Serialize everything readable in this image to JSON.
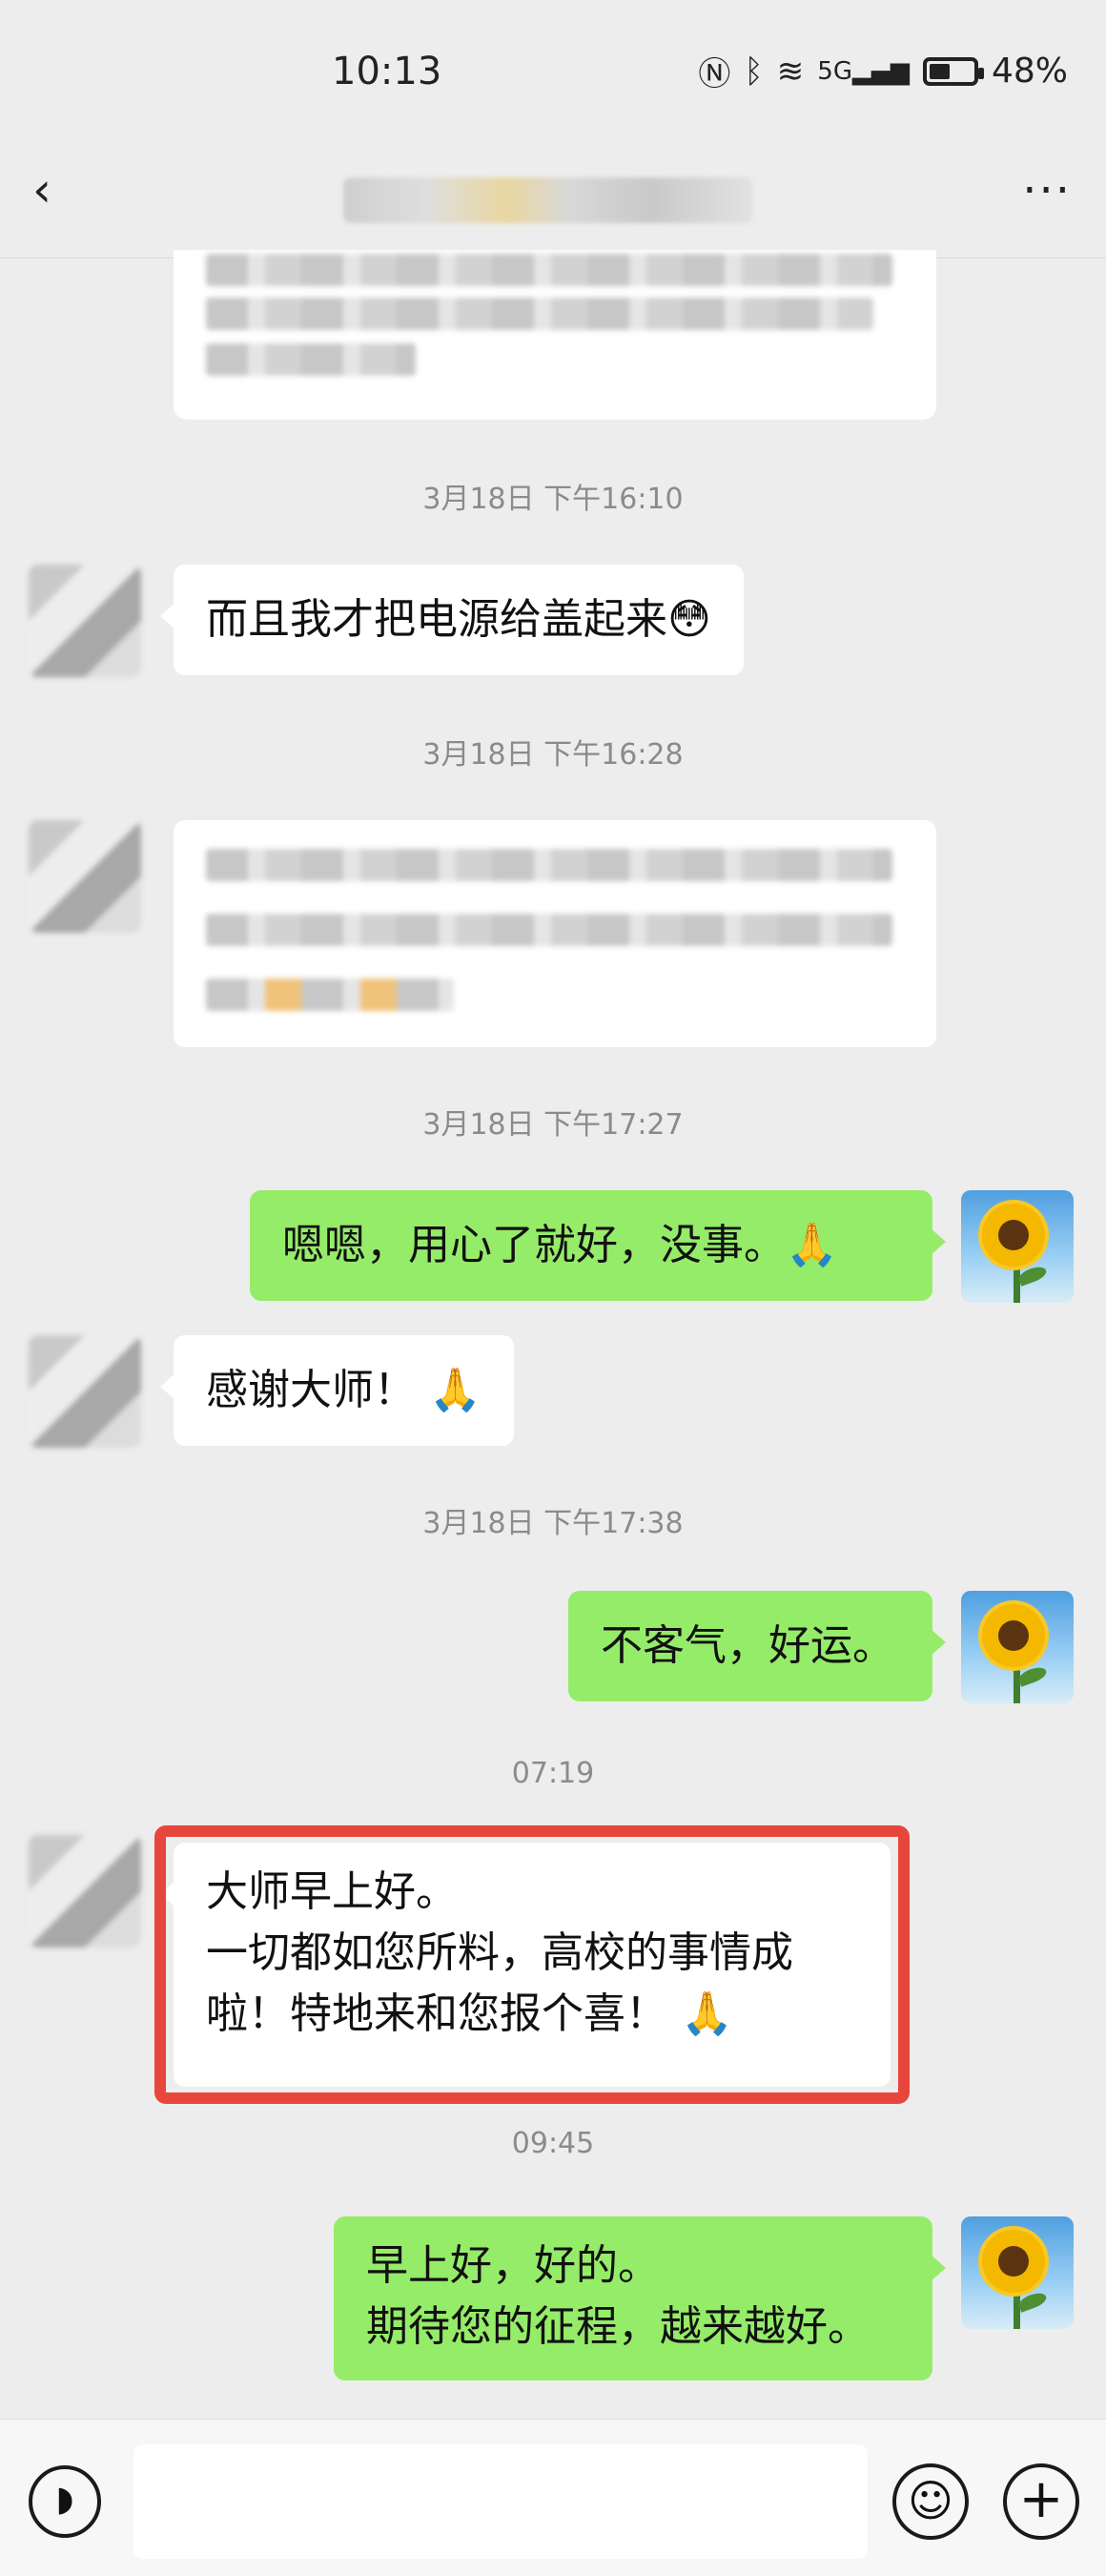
{
  "status": {
    "time": "10:13",
    "network": "5G",
    "battery": "48%"
  },
  "nav": {
    "back_icon": "back-arrow-icon",
    "title": "",
    "more_icon": "more-dots-icon"
  },
  "messages": [
    {
      "type": "timestamp",
      "text": "3月18日 下午16:10"
    },
    {
      "type": "in",
      "text": "而且我才把电源给盖起来😳"
    },
    {
      "type": "timestamp",
      "text": "3月18日 下午16:28"
    },
    {
      "type": "timestamp",
      "text": "3月18日 下午17:27"
    },
    {
      "type": "out",
      "text": "嗯嗯，用心了就好，没事。🙏"
    },
    {
      "type": "in",
      "text": "感谢大师！ 🙏"
    },
    {
      "type": "timestamp",
      "text": "3月18日 下午17:38"
    },
    {
      "type": "out",
      "text": "不客气，好运。"
    },
    {
      "type": "timestamp",
      "text": "07:19"
    },
    {
      "type": "in",
      "lines": [
        "大师早上好。",
        "一切都如您所料，高校的事情成",
        "啦！特地来和您报个喜！ 🙏"
      ]
    },
    {
      "type": "timestamp",
      "text": "09:45"
    },
    {
      "type": "out",
      "lines": [
        "早上好，好的。",
        "期待您的征程，越来越好。"
      ]
    }
  ],
  "input_bar": {
    "voice_icon": "voice-icon",
    "placeholder": "",
    "emoji_icon": "emoji-icon",
    "plus_icon": "plus-icon"
  },
  "colors": {
    "background": "#ededed",
    "outgoing_bubble": "#95ec69",
    "incoming_bubble": "#ffffff",
    "highlight": "#e8463c"
  }
}
